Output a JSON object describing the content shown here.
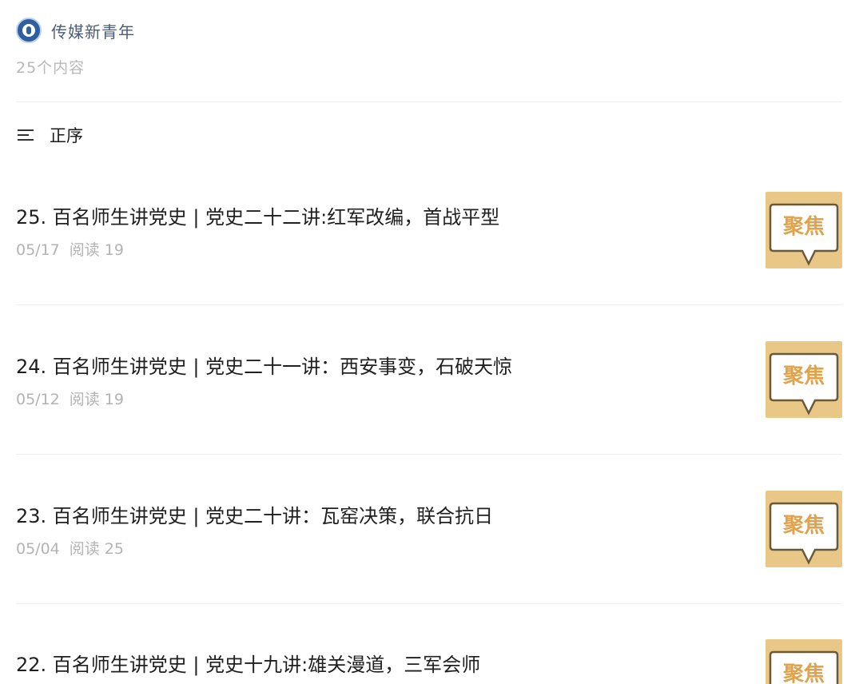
{
  "account": {
    "name": "传媒新青年",
    "count_text": "25个内容"
  },
  "sort": {
    "label": "正序"
  },
  "colors": {
    "thumb_bg": "#e9c787",
    "thumb_text": "#e0a24a",
    "title": "#1f1f1f",
    "meta": "#b3b3b3"
  },
  "articles": [
    {
      "title": "25. 百名师生讲党史 | 党史二十二讲:红军改编，首战平型",
      "date": "05/17",
      "reads": "阅读 19",
      "thumb_text": "聚焦"
    },
    {
      "title": "24. 百名师生讲党史 | 党史二十一讲：西安事变，石破天惊",
      "date": "05/12",
      "reads": "阅读 19",
      "thumb_text": "聚焦"
    },
    {
      "title": "23. 百名师生讲党史 | 党史二十讲：瓦窑决策，联合抗日",
      "date": "05/04",
      "reads": "阅读 25",
      "thumb_text": "聚焦"
    },
    {
      "title": "22. 百名师生讲党史 | 党史十九讲:雄关漫道，三军会师",
      "date": "",
      "reads": "",
      "thumb_text": "聚焦"
    }
  ]
}
